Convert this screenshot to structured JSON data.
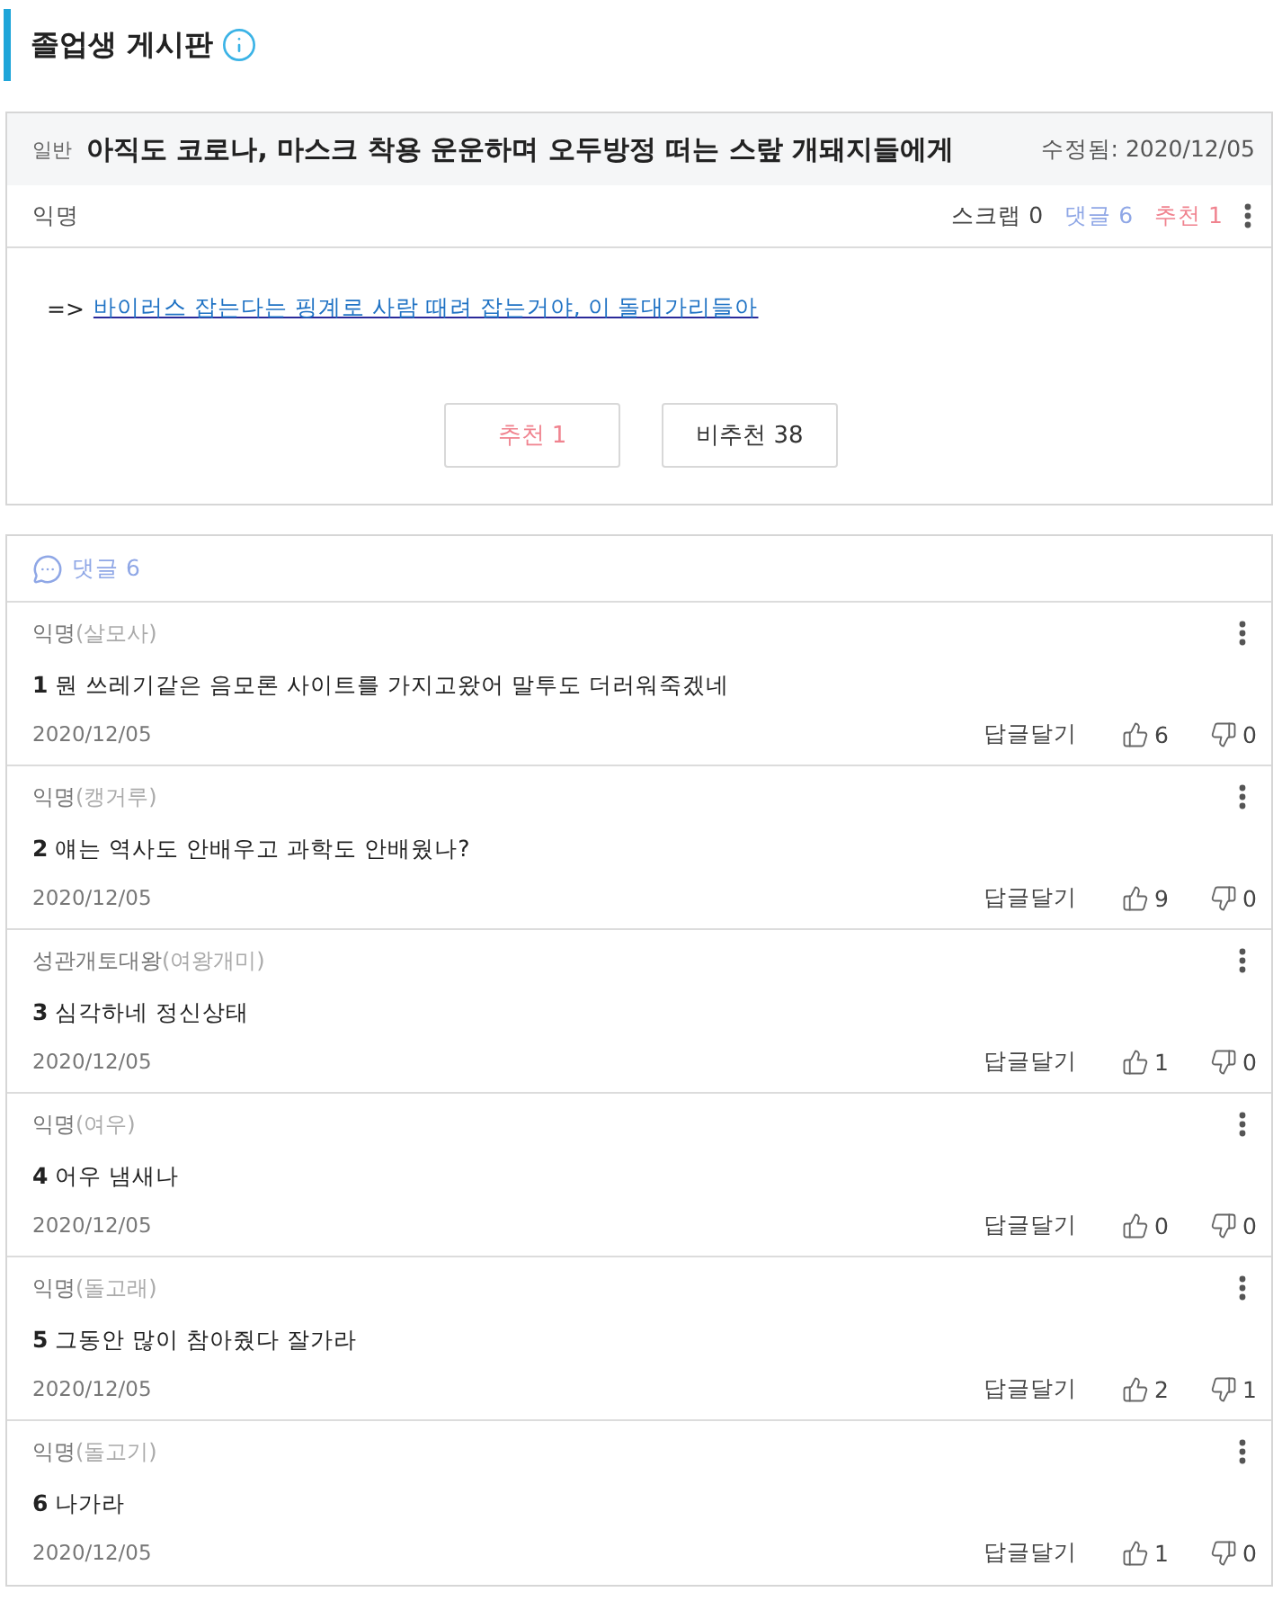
{
  "board": {
    "title": "졸업생 게시판"
  },
  "post": {
    "category": "일반",
    "title": "아직도 코로나, 마스크 착용 운운하며 오두방정 떠는 스랖 개돼지들에게",
    "edited": "수정됨: 2020/12/05",
    "author": "익명",
    "stats": [
      {
        "kind": "scrap",
        "label": "스크랩 0"
      },
      {
        "kind": "comments",
        "label": "댓글 6"
      },
      {
        "kind": "likes",
        "label": "추천 1"
      }
    ],
    "body": {
      "prefix": "=>",
      "link": "바이러스 잡는다는 핑계로 사람 때려 잡는거야, 이 돌대가리들아"
    },
    "vote_buttons": [
      {
        "kind": "up",
        "label": "추천 1"
      },
      {
        "kind": "down",
        "label": "비추천 38"
      }
    ]
  },
  "comments": {
    "header": "댓글 6",
    "items": [
      {
        "author": "익명",
        "nickname": "(살모사)",
        "number": "1",
        "text": "뭔 쓰레기같은 음모론 사이트를 가지고왔어 말투도 더러워죽겠네",
        "date": "2020/12/05",
        "reply": "답글달기",
        "likes": "6",
        "dislikes": "0"
      },
      {
        "author": "익명",
        "nickname": "(캥거루)",
        "number": "2",
        "text": "얘는 역사도 안배우고 과학도 안배웠나?",
        "date": "2020/12/05",
        "reply": "답글달기",
        "likes": "9",
        "dislikes": "0"
      },
      {
        "author": "성관개토대왕",
        "nickname": "(여왕개미)",
        "number": "3",
        "text": "심각하네 정신상태",
        "date": "2020/12/05",
        "reply": "답글달기",
        "likes": "1",
        "dislikes": "0"
      },
      {
        "author": "익명",
        "nickname": "(여우)",
        "number": "4",
        "text": "어우 냄새나",
        "date": "2020/12/05",
        "reply": "답글달기",
        "likes": "0",
        "dislikes": "0"
      },
      {
        "author": "익명",
        "nickname": "(돌고래)",
        "number": "5",
        "text": "그동안 많이 참아줬다 잘가라",
        "date": "2020/12/05",
        "reply": "답글달기",
        "likes": "2",
        "dislikes": "1"
      },
      {
        "author": "익명",
        "nickname": "(돌고기)",
        "number": "6",
        "text": "나가라",
        "date": "2020/12/05",
        "reply": "답글달기",
        "likes": "1",
        "dislikes": "0"
      }
    ]
  }
}
